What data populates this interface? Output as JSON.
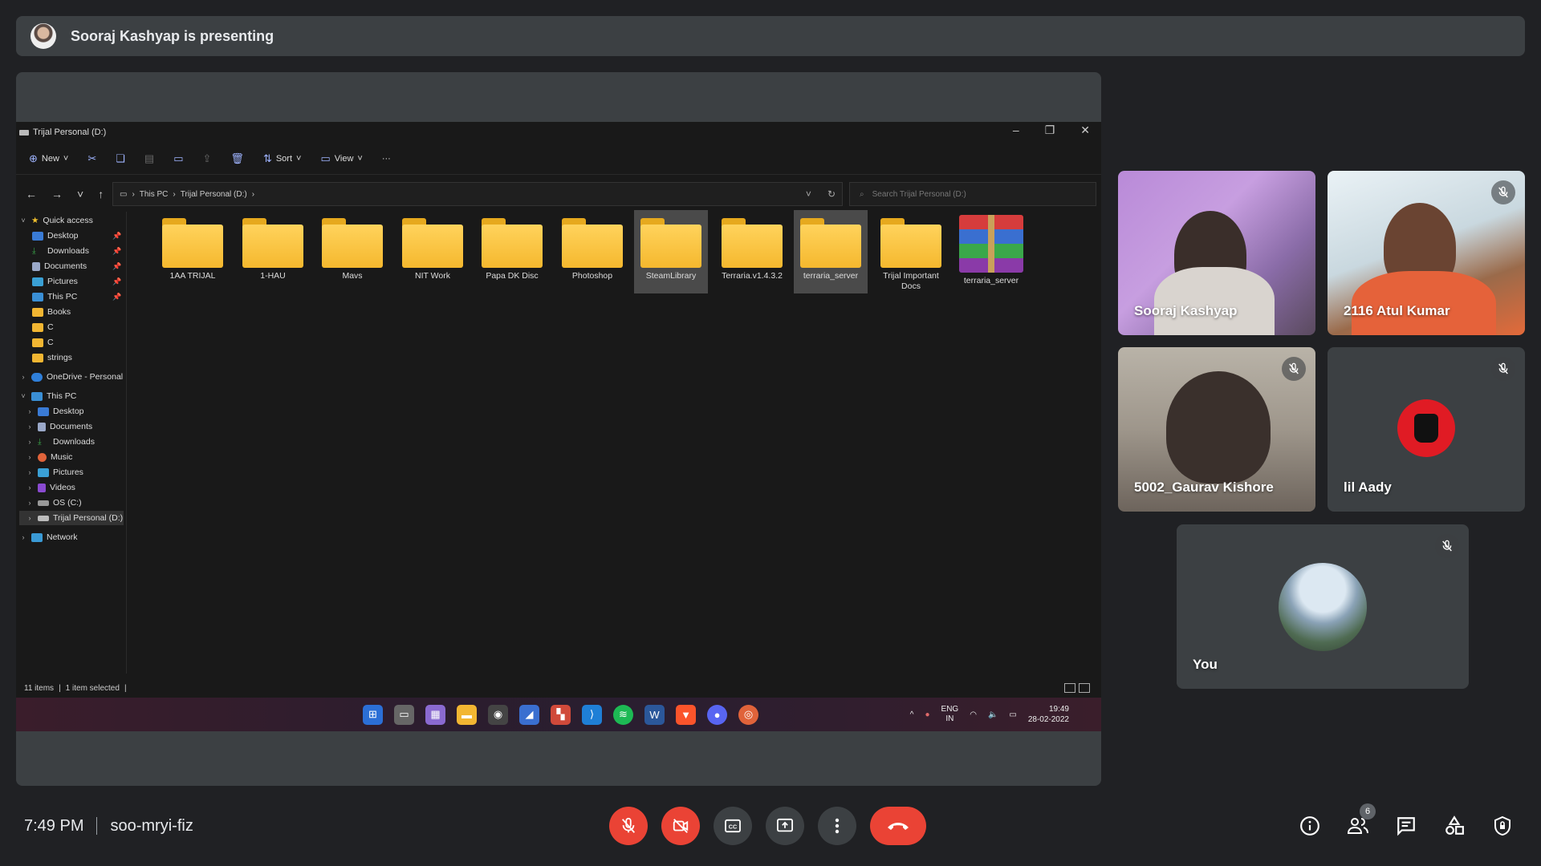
{
  "banner": {
    "text": "Sooraj Kashyap is presenting"
  },
  "explorer": {
    "title": "Trijal Personal (D:)",
    "toolbar": {
      "new": "New",
      "sort": "Sort",
      "view": "View",
      "more": "···"
    },
    "path": [
      "This PC",
      "Trijal Personal (D:)"
    ],
    "search_placeholder": "Search Trijal Personal (D:)",
    "nav": [
      "Quick access",
      "Desktop",
      "Downloads",
      "Documents",
      "Pictures",
      "This PC",
      "Books",
      "C",
      "C",
      "strings",
      "OneDrive - Personal",
      "This PC",
      "Desktop",
      "Documents",
      "Downloads",
      "Music",
      "Pictures",
      "Videos",
      "OS (C:)",
      "Trijal Personal (D:)",
      "Network"
    ],
    "files": [
      "1AA TRIJAL",
      "1-HAU",
      "Mavs",
      "NIT Work",
      "Papa DK Disc",
      "Photoshop",
      "SteamLibrary",
      "Terraria.v1.4.3.2",
      "terraria_server",
      "Trijal Important Docs",
      "terraria_server"
    ],
    "status": {
      "items": "11 items",
      "selected": "1 item selected"
    }
  },
  "taskbar": {
    "lang": "ENG",
    "region": "IN",
    "time": "19:49",
    "date": "28-02-2022"
  },
  "participants": [
    {
      "name": "Sooraj Kashyap"
    },
    {
      "name": "2116 Atul Kumar"
    },
    {
      "name": "5002_Gaurav Kishore"
    },
    {
      "name": "lil Aady"
    },
    {
      "name": "You"
    }
  ],
  "meeting": {
    "time": "7:49 PM",
    "code": "soo-mryi-fiz",
    "participant_count": "6"
  },
  "colors": {
    "accent_red": "#ea4335",
    "surface": "#3c4043",
    "background": "#202124"
  }
}
